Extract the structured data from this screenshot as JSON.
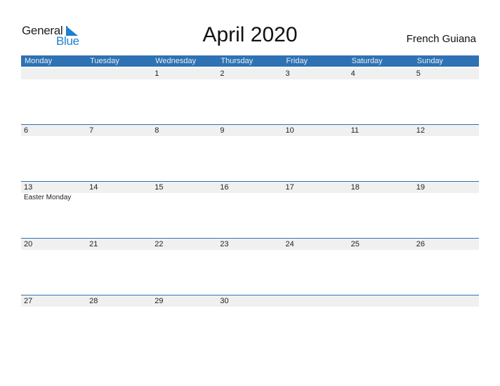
{
  "logo": {
    "line1": "General",
    "line2": "Blue",
    "accent_color": "#1f7fd0"
  },
  "header": {
    "title": "April 2020",
    "country": "French Guiana"
  },
  "weekdays": [
    "Monday",
    "Tuesday",
    "Wednesday",
    "Thursday",
    "Friday",
    "Saturday",
    "Sunday"
  ],
  "weeks": [
    {
      "days": [
        "",
        "",
        "1",
        "2",
        "3",
        "4",
        "5"
      ],
      "events": []
    },
    {
      "days": [
        "6",
        "7",
        "8",
        "9",
        "10",
        "11",
        "12"
      ],
      "events": []
    },
    {
      "days": [
        "13",
        "14",
        "15",
        "16",
        "17",
        "18",
        "19"
      ],
      "events": [
        {
          "col": 0,
          "label": "Easter Monday"
        }
      ]
    },
    {
      "days": [
        "20",
        "21",
        "22",
        "23",
        "24",
        "25",
        "26"
      ],
      "events": []
    },
    {
      "days": [
        "27",
        "28",
        "29",
        "30",
        "",
        "",
        ""
      ],
      "events": []
    }
  ],
  "colors": {
    "header_bg": "#2e72b3",
    "row_bg": "#f0f0f0"
  }
}
